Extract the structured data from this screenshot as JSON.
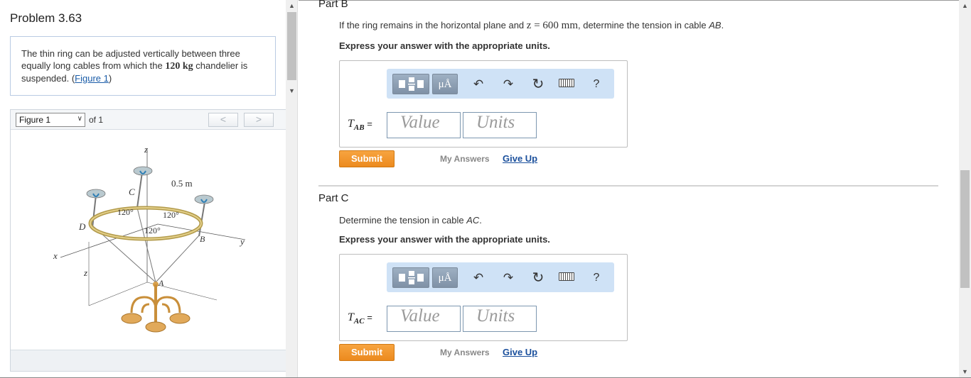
{
  "problem": {
    "title": "Problem 3.63",
    "text_before": "The thin ring can be adjusted vertically between three equally long cables from which the ",
    "mass": "120 kg",
    "text_after": " chandelier is suspended. (",
    "figure_link": "Figure 1",
    "text_close": ")"
  },
  "figure": {
    "selected": "Figure 1",
    "of_label": "of 1",
    "prev_label": "<",
    "next_label": ">",
    "labels": {
      "z_top": "z",
      "radius": "0.5 m",
      "C": "C",
      "D": "D",
      "B": "B",
      "A": "A",
      "angle1": "120°",
      "angle2": "120°",
      "angle3": "120°",
      "x": "x",
      "y": "y",
      "z_side": "z"
    }
  },
  "partB": {
    "title": "Part B",
    "prompt_before": "If the ring remains in the horizontal plane and ",
    "prompt_math": "z = 600 mm",
    "prompt_after": ", determine the tension in cable ",
    "prompt_cable": "AB",
    "prompt_end": ".",
    "instruction": "Express your answer with the appropriate units.",
    "var_main": "T",
    "var_sub": "AB",
    "equals": " =",
    "value_placeholder": "Value",
    "units_placeholder": "Units",
    "submit": "Submit",
    "my_answers": "My Answers",
    "give_up": "Give Up"
  },
  "partC": {
    "title": "Part C",
    "prompt_before": "Determine the tension in cable ",
    "prompt_cable": "AC",
    "prompt_end": ".",
    "instruction": "Express your answer with the appropriate units.",
    "var_main": "T",
    "var_sub": "AC",
    "equals": " =",
    "value_placeholder": "Value",
    "units_placeholder": "Units",
    "submit": "Submit",
    "my_answers": "My Answers",
    "give_up": "Give Up"
  },
  "toolbar": {
    "units_label": "μÅ",
    "undo_glyph": "↶",
    "redo_glyph": "↷",
    "reset_glyph": "↻",
    "help_label": "?"
  },
  "scrollbar": {
    "up_glyph": "▲",
    "down_glyph": "▼"
  }
}
